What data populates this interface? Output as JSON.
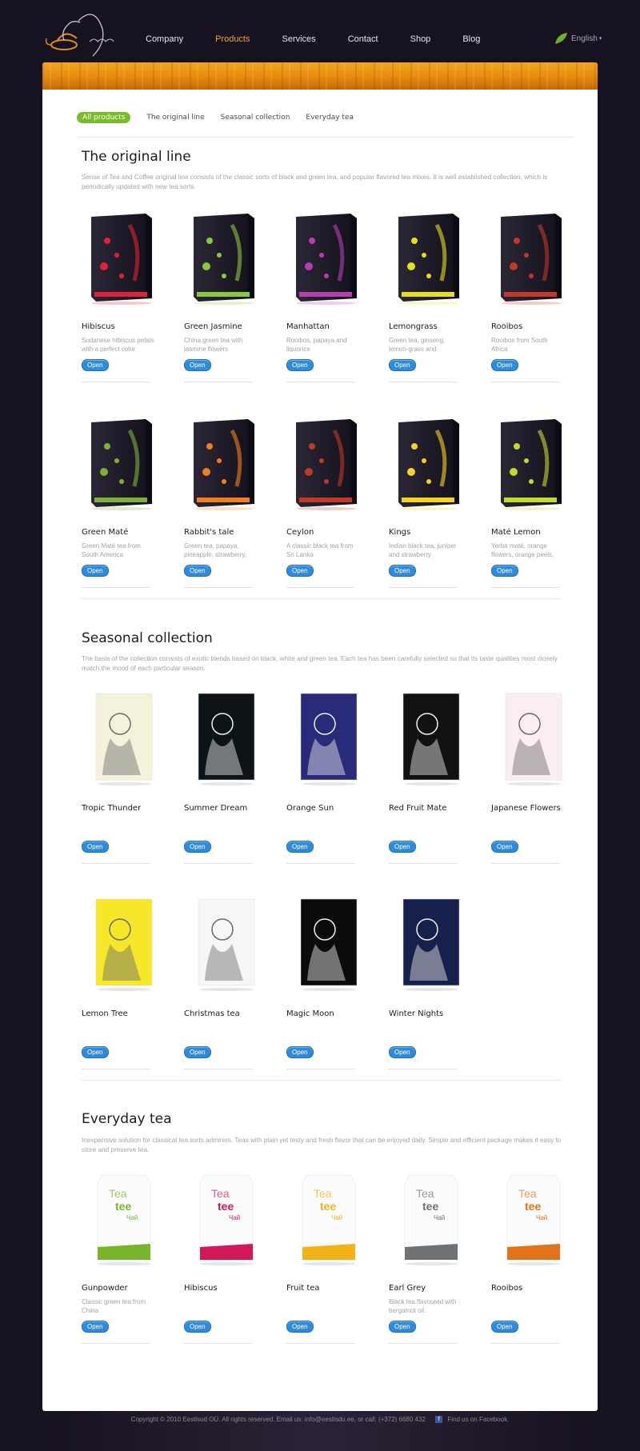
{
  "header": {
    "nav": [
      "Company",
      "Products",
      "Services",
      "Contact",
      "Shop",
      "Blog"
    ],
    "active_nav": "Products",
    "language": "English"
  },
  "tabs": [
    "All products",
    "The original line",
    "Seasonal collection",
    "Everyday tea"
  ],
  "sections": {
    "original": {
      "title": "The original line",
      "desc": "Sense of Tea and Coffee original line consists of the classic sorts of black and green tea, and popular flavored tea mixes. It is well established collection, which is periodically updated with new tea sorts.",
      "items": [
        {
          "name": "Hibiscus",
          "desc": "Sudanese hibiscus petals with a perfect color",
          "accent": "#e0203a"
        },
        {
          "name": "Green Jasmine",
          "desc": "China green tea with jasmine flowers",
          "accent": "#8bc63f"
        },
        {
          "name": "Manhattan",
          "desc": "Rooibos, papaya and liquorice",
          "accent": "#b63fb0"
        },
        {
          "name": "Lemongrass",
          "desc": "Green tea, ginseng, lemon-grass and",
          "accent": "#e3e11a"
        },
        {
          "name": "Rooibos",
          "desc": "Rooibos from South Africa",
          "accent": "#c0392b"
        },
        {
          "name": "Green Maté",
          "desc": "Green Maté tea from South America",
          "accent": "#7fb03a"
        },
        {
          "name": "Rabbit's tale",
          "desc": "Green tea, papaya, pineapple, strawberry,",
          "accent": "#f0801f"
        },
        {
          "name": "Ceylon",
          "desc": "A classic black tea from Sri Lanka",
          "accent": "#c0392b"
        },
        {
          "name": "Kings",
          "desc": "Indian black tea, juniper and strawberry",
          "accent": "#f5d320"
        },
        {
          "name": "Maté Lemon",
          "desc": "Yerba maté, orange flowers, orange peels,",
          "accent": "#c6d92e"
        }
      ]
    },
    "seasonal": {
      "title": "Seasonal collection",
      "desc": "The basis of the collection consists of exotic blends based on black, white and green tea. Each tea has been carefully selected so that its taste qualities most closely match the mood of each particular season.",
      "items": [
        {
          "name": "Tropic Thunder",
          "desc": "",
          "accent": "#f5f2dc"
        },
        {
          "name": "Summer Dream",
          "desc": "",
          "accent": "#0c1418"
        },
        {
          "name": "Orange Sun",
          "desc": "",
          "accent": "#2a2a7a"
        },
        {
          "name": "Red Fruit Mate",
          "desc": "",
          "accent": "#111111"
        },
        {
          "name": "Japanese Flowers",
          "desc": "",
          "accent": "#fbeef0"
        },
        {
          "name": "Lemon Tree",
          "desc": "",
          "accent": "#f6e72a"
        },
        {
          "name": "Christmas tea",
          "desc": "",
          "accent": "#f6f6f6"
        },
        {
          "name": "Magic Moon",
          "desc": "",
          "accent": "#0b0b0b"
        },
        {
          "name": "Winter Nights",
          "desc": "",
          "accent": "#16204a"
        }
      ]
    },
    "everyday": {
      "title": "Everyday tea",
      "desc": "Inexpensive solution for classical tea sorts admirers. Teas with plain yet testy and fresh flavor that can be enjoyed daily. Simple and efficient package makes it easy to store and preserve tea.",
      "items": [
        {
          "name": "Gunpowder",
          "desc": "Classic green tea from China",
          "accent": "#78b52c"
        },
        {
          "name": "Hibiscus",
          "desc": "",
          "accent": "#d0185a"
        },
        {
          "name": "Fruit tea",
          "desc": "",
          "accent": "#f2b21a"
        },
        {
          "name": "Earl Grey",
          "desc": "Black tea flavoured with bergamot oil.",
          "accent": "#6f7376"
        },
        {
          "name": "Rooibos",
          "desc": "",
          "accent": "#e0731c"
        }
      ]
    }
  },
  "button_label": "Open",
  "pack_text": {
    "tea": "Tea",
    "tee": "tee",
    "chai": "Чай"
  },
  "footer": {
    "copyright": "Copyright © 2010 Eestisud OÜ. All rights reserved. Email us: info@eestisdu.ee, or call: (+372) 6680 432",
    "facebook": "Find us on Facebook."
  },
  "colors": {
    "active_nav": "#f0a33c",
    "tab_active": "#78bc2a",
    "button": "#2f8ad8"
  }
}
